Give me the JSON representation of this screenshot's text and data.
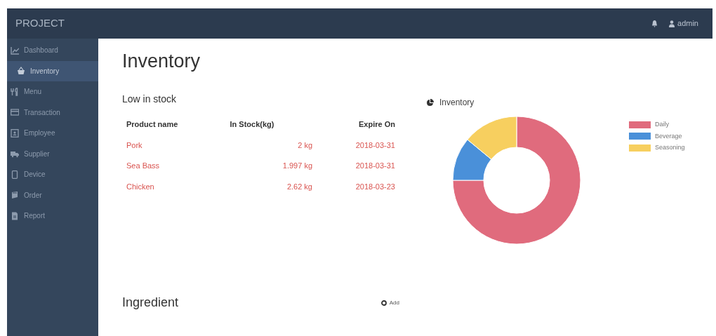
{
  "navbar": {
    "brand": "PROJECT",
    "user": "admin"
  },
  "sidebar": {
    "items": [
      {
        "label": "Dashboard",
        "selected": false,
        "children": [
          {
            "label": "Inventory",
            "selected": true
          }
        ]
      },
      {
        "label": "Menu",
        "selected": false
      },
      {
        "label": "Transaction",
        "selected": false
      },
      {
        "label": "Employee",
        "selected": false
      },
      {
        "label": "Supplier",
        "selected": false
      },
      {
        "label": "Device",
        "selected": false
      },
      {
        "label": "Order",
        "selected": false
      },
      {
        "label": "Report",
        "selected": false
      }
    ]
  },
  "page_title": "Inventory",
  "low_stock": {
    "title": "Low in stock",
    "columns": [
      "Product name",
      "In Stock(kg)",
      "Expire On"
    ],
    "rows": [
      [
        "Pork",
        "2 kg",
        "2018-03-31"
      ],
      [
        "Sea Bass",
        "1.997 kg",
        "2018-03-31"
      ],
      [
        "Chicken",
        "2.62 kg",
        "2018-03-23"
      ]
    ]
  },
  "inventory_chart": {
    "title": "Inventory",
    "chart_data": {
      "type": "donut",
      "categories": [
        "Daily",
        "Beverage",
        "Seasoning"
      ],
      "values": [
        75,
        11,
        14
      ],
      "colors": [
        "#e06b7d",
        "#4a90d9",
        "#f7cf5f"
      ],
      "legend": "right"
    }
  },
  "ingredient": {
    "title": "Ingredient",
    "add_label": "Add"
  }
}
